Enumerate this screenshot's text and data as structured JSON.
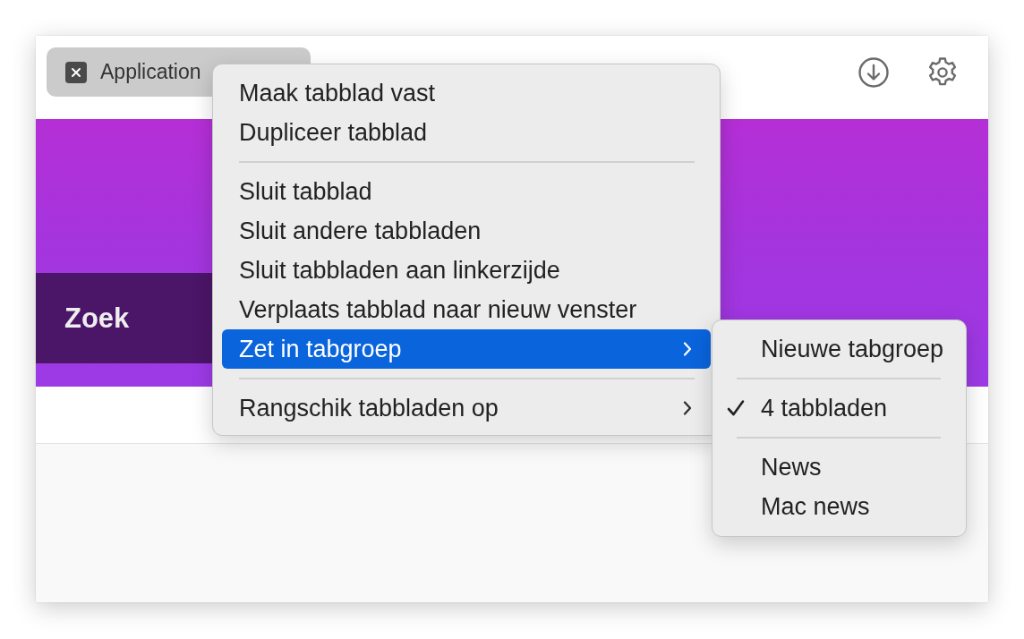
{
  "tab": {
    "title": "Application"
  },
  "banner": {
    "search_label": "Zoek"
  },
  "context_menu": {
    "items": [
      {
        "kind": "item",
        "label": "Maak tabblad vast",
        "selected": false,
        "has_submenu": false
      },
      {
        "kind": "item",
        "label": "Dupliceer tabblad",
        "selected": false,
        "has_submenu": false
      },
      {
        "kind": "separator"
      },
      {
        "kind": "item",
        "label": "Sluit tabblad",
        "selected": false,
        "has_submenu": false
      },
      {
        "kind": "item",
        "label": "Sluit andere tabbladen",
        "selected": false,
        "has_submenu": false
      },
      {
        "kind": "item",
        "label": "Sluit tabbladen aan linkerzijde",
        "selected": false,
        "has_submenu": false
      },
      {
        "kind": "item",
        "label": "Verplaats tabblad naar nieuw venster",
        "selected": false,
        "has_submenu": false
      },
      {
        "kind": "item",
        "label": "Zet in tabgroep",
        "selected": true,
        "has_submenu": true
      },
      {
        "kind": "separator"
      },
      {
        "kind": "item",
        "label": "Rangschik tabbladen op",
        "selected": false,
        "has_submenu": true
      }
    ]
  },
  "submenu": {
    "items": [
      {
        "kind": "item",
        "label": "Nieuwe tabgroep",
        "checked": false
      },
      {
        "kind": "separator"
      },
      {
        "kind": "item",
        "label": "4 tabbladen",
        "checked": true
      },
      {
        "kind": "separator"
      },
      {
        "kind": "item",
        "label": "News",
        "checked": false
      },
      {
        "kind": "item",
        "label": "Mac news",
        "checked": false
      }
    ]
  }
}
